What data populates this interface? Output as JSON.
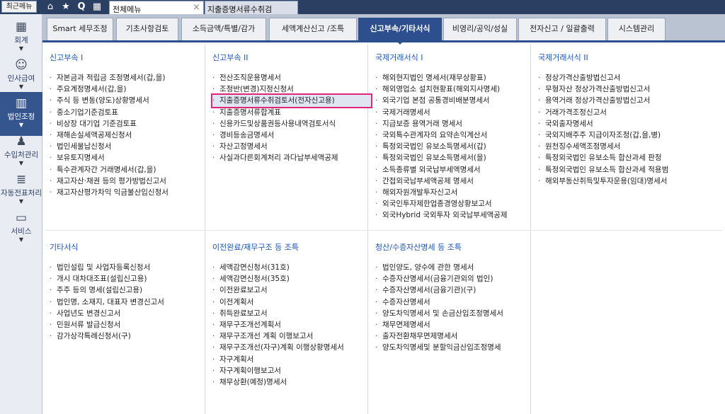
{
  "topbar": {
    "recent_label": "최근메뉴",
    "tab_main": "전체메뉴",
    "tab_doc": "지출증명서류수취검",
    "close_symbol": "×"
  },
  "sidebar": [
    {
      "label": "회계",
      "icon": "calculator-icon"
    },
    {
      "label": "인사급여",
      "icon": "person-icon"
    },
    {
      "label": "법인조정",
      "icon": "building-icon",
      "active": true
    },
    {
      "label": "수입처관리",
      "icon": "people-icon"
    },
    {
      "label": "자동전표처리",
      "icon": "database-icon"
    },
    {
      "label": "서비스",
      "icon": "monitor-icon"
    }
  ],
  "menubar": [
    "Smart 세무조정",
    "기초사항검토",
    "소득금액/특별/감가",
    "세액계산신고 /조특",
    "신고부속/기타서식",
    "비영리/공익/성실",
    "전자신고 / 일괄출력",
    "시스템관리"
  ],
  "active_menu_index": 4,
  "sections": {
    "s1": {
      "title": "신고부속 I",
      "items": [
        "자본금과 적립금 조정명세서(갑,을)",
        "주요계정명세서(갑,을)",
        "주식 등 변동(양도)상황명세서",
        "중소기업기준검토표",
        "비상장 대기업 기준검토표",
        "재해손실세액공제신청서",
        "법인세물납신청서",
        "보유토지명세서",
        "특수관계자간 거래명세서(갑,을)",
        "재고자산·채권 등의 평가방법신고서",
        "재고자산평가차익 익금불산입신청서"
      ]
    },
    "s2": {
      "title": "신고부속 II",
      "items": [
        "전산조직운용명세서",
        "조정반(변경)지정신청서",
        "지출증명서류수취검토서(전자신고용)",
        "지출증명서류합계표",
        "신용카드및상품권등사용내역검토서식",
        "경비등송금명세서",
        "자산고정명세서",
        "사실과다른회계처리 과다납부세액공제"
      ],
      "selected": 2
    },
    "s3": {
      "title": "국제거래서식 I",
      "items": [
        "해외현지법인 명세서(재무상황표)",
        "해외영업소 설치현황표(해외지사명세)",
        "외국기업 본점 공통경비배분명세서",
        "국제거래명세서",
        "지급보증 용역거래 명세서",
        "국외특수관계자의 요약손익계산서",
        "특정외국법인 유보소득명세서(갑)",
        "특정외국법인 유보소득명세서(을)",
        "소득종류별 외국납부세액명세서",
        "간접외국납부세액공제 명세서",
        "해외자원개발투자신고서",
        "외국인투자제한업종경영상황보고서",
        "외국Hybrid 국외투자 외국납부세액공제"
      ]
    },
    "s4": {
      "title": "국제거래서식 II",
      "items": [
        "정상가격산출방법신고서",
        "무형자산 정상가격산출방법신고서",
        "용역거래 정상가격산출방법신고서",
        "거래가격조정신고서",
        "국외출자명세서",
        "국외지배주주 지급이자조정(갑,을,병)",
        "원천징수세액조정명세서",
        "특정외국법인 유보소득 합산과세 판정",
        "특정외국법인 유보소득 합산과세 적용범",
        "해외부동산취득및투자운용(임대)명세서"
      ]
    },
    "s5": {
      "title": "기타서식",
      "items": [
        "법인설립 및 사업자등록신청서",
        "개시 대차대조표(설립신고용)",
        "주주 등의 명세(설립신고용)",
        "법인명, 소재지, 대표자 변경신고서",
        "사업년도 변경신고서",
        "민원서류 발급신청서",
        "감가상각특례신청서(구)"
      ]
    },
    "s6": {
      "title": "이전완료/재무구조 등 조특",
      "items": [
        "세액감면신청서(31호)",
        "세액감면신청서(35호)",
        "이전완료보고서",
        "이전계획서",
        "취득완료보고서",
        "재무구조개선계획서",
        "재무구조개선 계획 이행보고서",
        "재무구조개선(자구)계획 이행상황명세서",
        "자구계획서",
        "자구계획이행보고서",
        "채무상환(예정)명세서"
      ]
    },
    "s7": {
      "title": "청산/수증자산명세 등 조특",
      "items": [
        "법인양도, 양수에 관한 명세서",
        "수증자산명세서(금융기관외의 법인)",
        "수증자산명세서(금융기관)(구)",
        "수증자산명세서",
        "양도차익명세서 및 손금산입조정명세서",
        "채무면제명세서",
        "출자전환채무면제명세서",
        "양도차익명세및 분할익금산입조정명세"
      ]
    }
  },
  "colors": {
    "accent": "#2d4f8e",
    "section_title": "#1d55b3",
    "selection_border": "#e0257a"
  }
}
